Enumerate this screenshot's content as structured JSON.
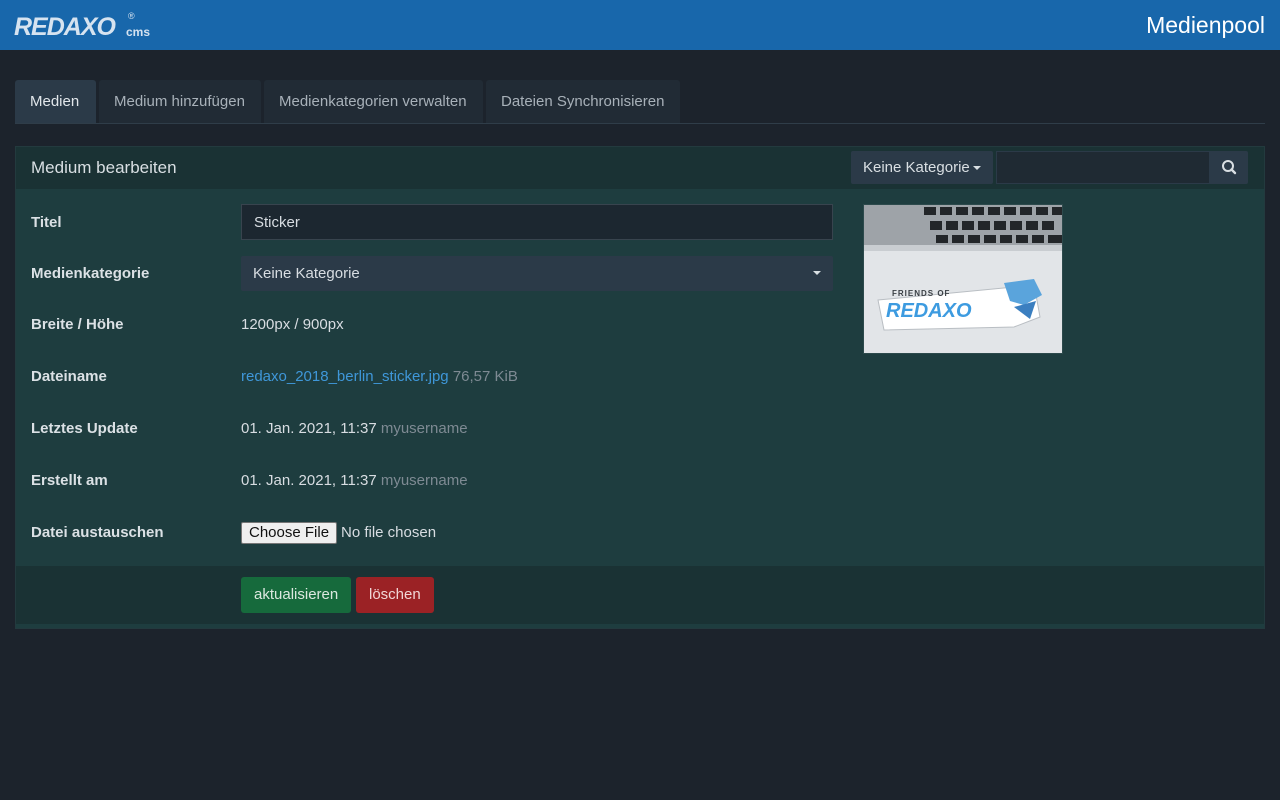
{
  "app": {
    "logo_main": "REDAXO",
    "logo_sup": "®",
    "logo_sub": "cms",
    "page_title": "Medienpool"
  },
  "tabs": [
    {
      "label": "Medien",
      "active": true
    },
    {
      "label": "Medium hinzufügen",
      "active": false
    },
    {
      "label": "Medienkategorien verwalten",
      "active": false
    },
    {
      "label": "Dateien Synchronisieren",
      "active": false
    }
  ],
  "panel": {
    "title": "Medium bearbeiten",
    "category_filter": "Keine Kategorie",
    "search_value": "",
    "search_icon": "search-icon"
  },
  "form": {
    "title_label": "Titel",
    "title_value": "Sticker",
    "category_label": "Medienkategorie",
    "category_value": "Keine Kategorie",
    "dimensions_label": "Breite / Höhe",
    "dimensions_value": "1200px / 900px",
    "filename_label": "Dateiname",
    "filename_value": "redaxo_2018_berlin_sticker.jpg",
    "filesize_value": "76,57 KiB",
    "updated_label": "Letztes Update",
    "updated_value": "01. Jan. 2021, 11:37",
    "updated_user": "myusername",
    "created_label": "Erstellt am",
    "created_value": "01. Jan. 2021, 11:37",
    "created_user": "myusername",
    "replace_label": "Datei austauschen",
    "file_button": "Choose File",
    "file_status": "No file chosen"
  },
  "preview": {
    "sticker_top": "FRIENDS OF",
    "sticker_main": "REDAXO"
  },
  "actions": {
    "update_label": "aktualisieren",
    "delete_label": "löschen"
  },
  "colors": {
    "header": "#1867ab",
    "background": "#1c232c",
    "panel": "#1e3d3f",
    "link": "#3f97d9",
    "update_button": "#166a3c",
    "delete_button": "#9b2225"
  }
}
